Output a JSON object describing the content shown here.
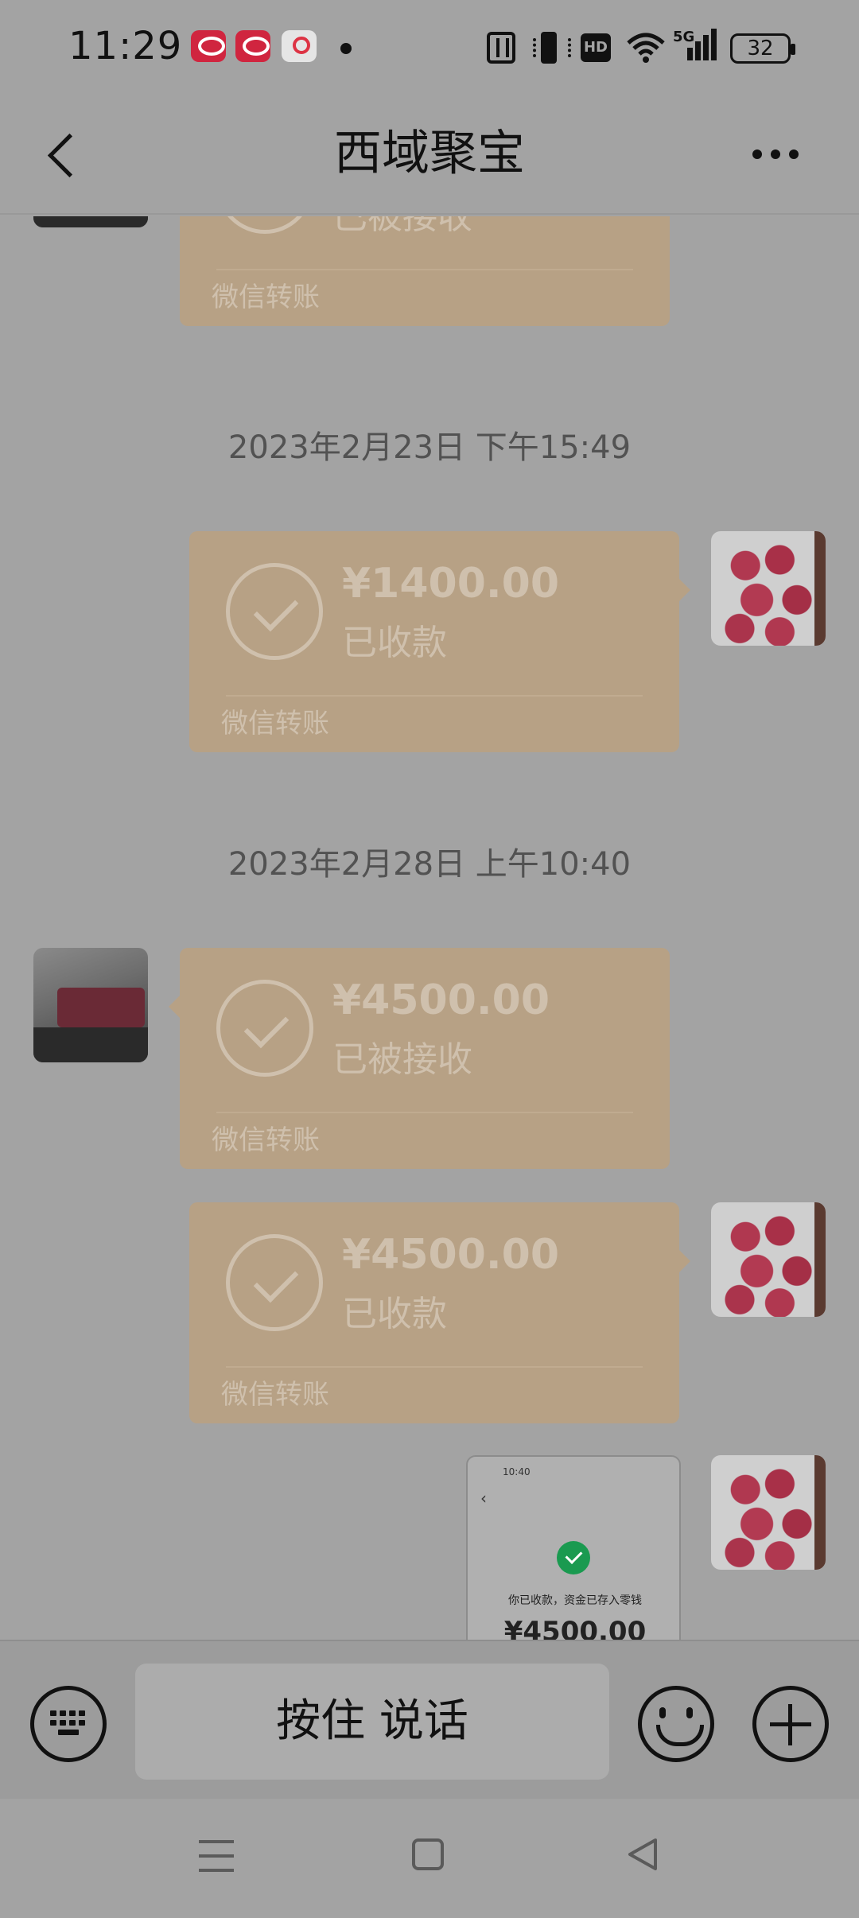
{
  "status_bar": {
    "time": "11:29",
    "network": "5G",
    "hd": "HD",
    "battery": "32",
    "icons": [
      "app-notification-icon",
      "app-notification-icon",
      "map-app-icon",
      "notification-dot-icon",
      "nfc-icon",
      "vibrate-icon",
      "wifi-icon",
      "signal-icon",
      "battery-icon"
    ]
  },
  "header": {
    "title": "西域聚宝",
    "back_icon": "back-arrow-icon",
    "more_icon": "more-dots-icon"
  },
  "messages": [
    {
      "type": "transfer",
      "side": "left",
      "amount": "",
      "status": "已被接收",
      "footer": "微信转账"
    },
    {
      "type": "timestamp",
      "text": "2023年2月23日 下午15:49"
    },
    {
      "type": "transfer",
      "side": "right",
      "amount": "¥1400.00",
      "status": "已收款",
      "footer": "微信转账"
    },
    {
      "type": "timestamp",
      "text": "2023年2月28日 上午10:40"
    },
    {
      "type": "transfer",
      "side": "left",
      "amount": "¥4500.00",
      "status": "已被接收",
      "footer": "微信转账"
    },
    {
      "type": "transfer",
      "side": "right",
      "amount": "¥4500.00",
      "status": "已收款",
      "footer": "微信转账"
    },
    {
      "type": "image",
      "side": "right",
      "time": "10:40",
      "text": "你已收款，资金已存入零钱",
      "amount": "¥4500.00"
    }
  ],
  "input_bar": {
    "voice_label": "按住 说话",
    "keyboard_icon": "keyboard-icon",
    "emoji_icon": "emoji-icon",
    "plus_icon": "plus-icon"
  },
  "nav_bar": {
    "icons": [
      "menu-icon",
      "home-icon",
      "back-triangle-icon"
    ]
  },
  "colors": {
    "background": "#a3a3a3",
    "transfer_card": "#b7a185",
    "transfer_text": "#cfc0ad",
    "success_green": "#1a9a50"
  }
}
